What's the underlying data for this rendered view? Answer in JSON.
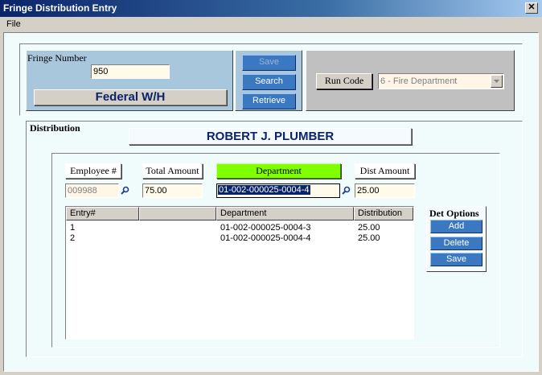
{
  "window": {
    "title": "Fringe Distribution Entry",
    "close_glyph": "✕"
  },
  "menu": {
    "file": "File"
  },
  "fringe": {
    "label": "Fringe Number",
    "value": "950",
    "name": "Federal W/H"
  },
  "actions": {
    "save": "Save",
    "search": "Search",
    "retrieve": "Retrieve"
  },
  "run_code": {
    "label": "Run Code",
    "value": "6 - Fire Department"
  },
  "distribution": {
    "section_label": "Distribution",
    "employee_name": "ROBERT J. PLUMBER",
    "headers": {
      "employee": "Employee #",
      "total_amount": "Total Amount",
      "department": "Department",
      "dist_amount": "Dist Amount"
    },
    "values": {
      "employee": "009988",
      "total_amount": "75.00",
      "department": "01-002-000025-0004-4",
      "dist_amount": "25.00"
    },
    "table": {
      "columns": [
        "Entry#",
        "",
        "Department",
        "Distribution"
      ],
      "rows": [
        {
          "entry": "1",
          "department": "01-002-000025-0004-3",
          "distribution": "25.00"
        },
        {
          "entry": "2",
          "department": "01-002-000025-0004-4",
          "distribution": "25.00"
        }
      ]
    }
  },
  "det_options": {
    "title": "Det Options",
    "add": "Add",
    "delete": "Delete",
    "save": "Save"
  },
  "colors": {
    "accent_green": "#80ff00",
    "title_blue": "#0a246a",
    "button_blue": "#3a78c2"
  }
}
